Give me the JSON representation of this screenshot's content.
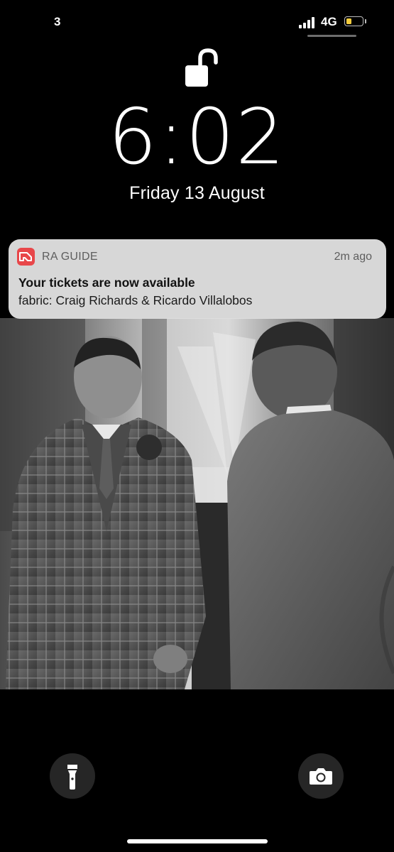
{
  "status_bar": {
    "carrier": "3",
    "network": "4G",
    "signal_bars": 4,
    "battery_level": 0.35,
    "battery_color": "#f5cd3d"
  },
  "lock_screen": {
    "time": "6:02",
    "date": "Friday 13 August",
    "lock_state": "unlocked"
  },
  "notification": {
    "app_icon": "ra-guide-logo-icon",
    "app_icon_color": "#e8474a",
    "app_name": "RA GUIDE",
    "time_ago": "2m ago",
    "title": "Your tickets are now available",
    "body": "fabric: Craig Richards & Ricardo Villalobos"
  },
  "controls": {
    "left_icon": "flashlight-icon",
    "right_icon": "camera-icon"
  }
}
